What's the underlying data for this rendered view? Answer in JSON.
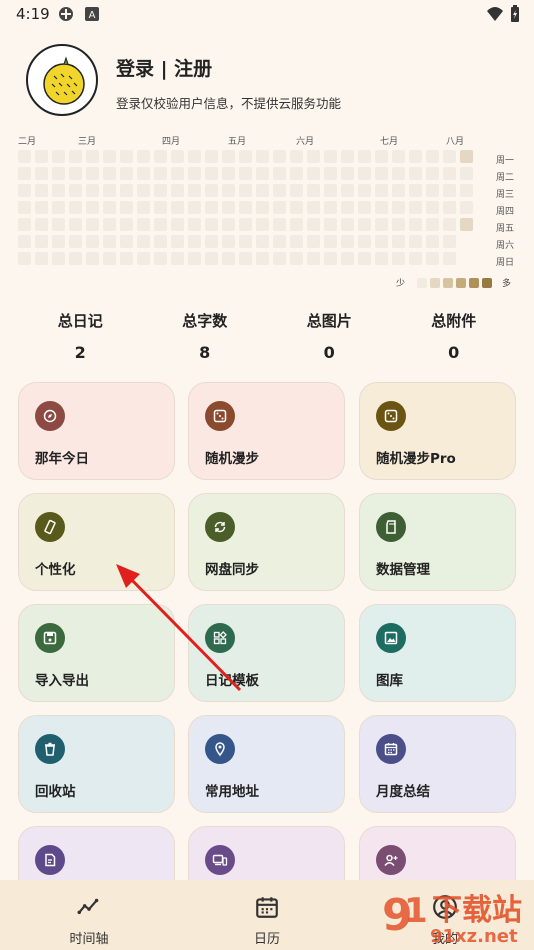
{
  "status_bar": {
    "time": "4:19"
  },
  "header": {
    "title": "登录 | 注册",
    "subtitle": "登录仅校验用户信息，不提供云服务功能"
  },
  "heatmap": {
    "months": [
      "二月",
      "三月",
      "四月",
      "五月",
      "六月",
      "七月",
      "八月"
    ],
    "weekdays": [
      "周一",
      "周二",
      "周三",
      "周四",
      "周五",
      "周六",
      "周日"
    ],
    "legend_low": "少",
    "legend_high": "多",
    "legend_colors": [
      "#f2ebe1",
      "#e4d8c3",
      "#d6c4a1",
      "#c4ab7c",
      "#ae915a",
      "#977a3f"
    ]
  },
  "stats": [
    {
      "label": "总日记",
      "value": "2"
    },
    {
      "label": "总字数",
      "value": "8"
    },
    {
      "label": "总图片",
      "value": "0"
    },
    {
      "label": "总附件",
      "value": "0"
    }
  ],
  "grid": [
    {
      "label": "那年今日",
      "icon": "compass-icon",
      "bg": "#fbe8e3",
      "iconbg": "#8d4a43"
    },
    {
      "label": "随机漫步",
      "icon": "dice-icon",
      "bg": "#fbe8e3",
      "iconbg": "#8a4a2e"
    },
    {
      "label": "随机漫步Pro",
      "icon": "dice-icon",
      "bg": "#f6ecd8",
      "iconbg": "#6b5314"
    },
    {
      "label": "个性化",
      "icon": "phone-rotate-icon",
      "bg": "#f1efdc",
      "iconbg": "#585a1c"
    },
    {
      "label": "网盘同步",
      "icon": "sync-icon",
      "bg": "#ecf0df",
      "iconbg": "#4b5e2a"
    },
    {
      "label": "数据管理",
      "icon": "sd-card-icon",
      "bg": "#e8f0df",
      "iconbg": "#3e5f34"
    },
    {
      "label": "导入导出",
      "icon": "save-icon",
      "bg": "#e6efe0",
      "iconbg": "#3b6a3e"
    },
    {
      "label": "日记模板",
      "icon": "widgets-icon",
      "bg": "#e3efe6",
      "iconbg": "#2f6a4f"
    },
    {
      "label": "图库",
      "icon": "image-icon",
      "bg": "#e0efec",
      "iconbg": "#1d6c62"
    },
    {
      "label": "回收站",
      "icon": "trash-icon",
      "bg": "#e1ecef",
      "iconbg": "#205f6e"
    },
    {
      "label": "常用地址",
      "icon": "location-icon",
      "bg": "#e4e9f3",
      "iconbg": "#34568a"
    },
    {
      "label": "月度总结",
      "icon": "calendar-icon",
      "bg": "#e9e7f4",
      "iconbg": "#4a4f8a"
    },
    {
      "label": "",
      "icon": "memo-icon",
      "bg": "#efe6f3",
      "iconbg": "#5e4a8a"
    },
    {
      "label": "",
      "icon": "devices-icon",
      "bg": "#f2e5f2",
      "iconbg": "#6a4b8a"
    },
    {
      "label": "",
      "icon": "person-add-icon",
      "bg": "#f5e5ee",
      "iconbg": "#7a4d72"
    }
  ],
  "nav": [
    {
      "label": "时间轴",
      "icon": "timeline-icon"
    },
    {
      "label": "日历",
      "icon": "calendar-icon"
    },
    {
      "label": "我的",
      "icon": "profile-icon"
    }
  ]
}
